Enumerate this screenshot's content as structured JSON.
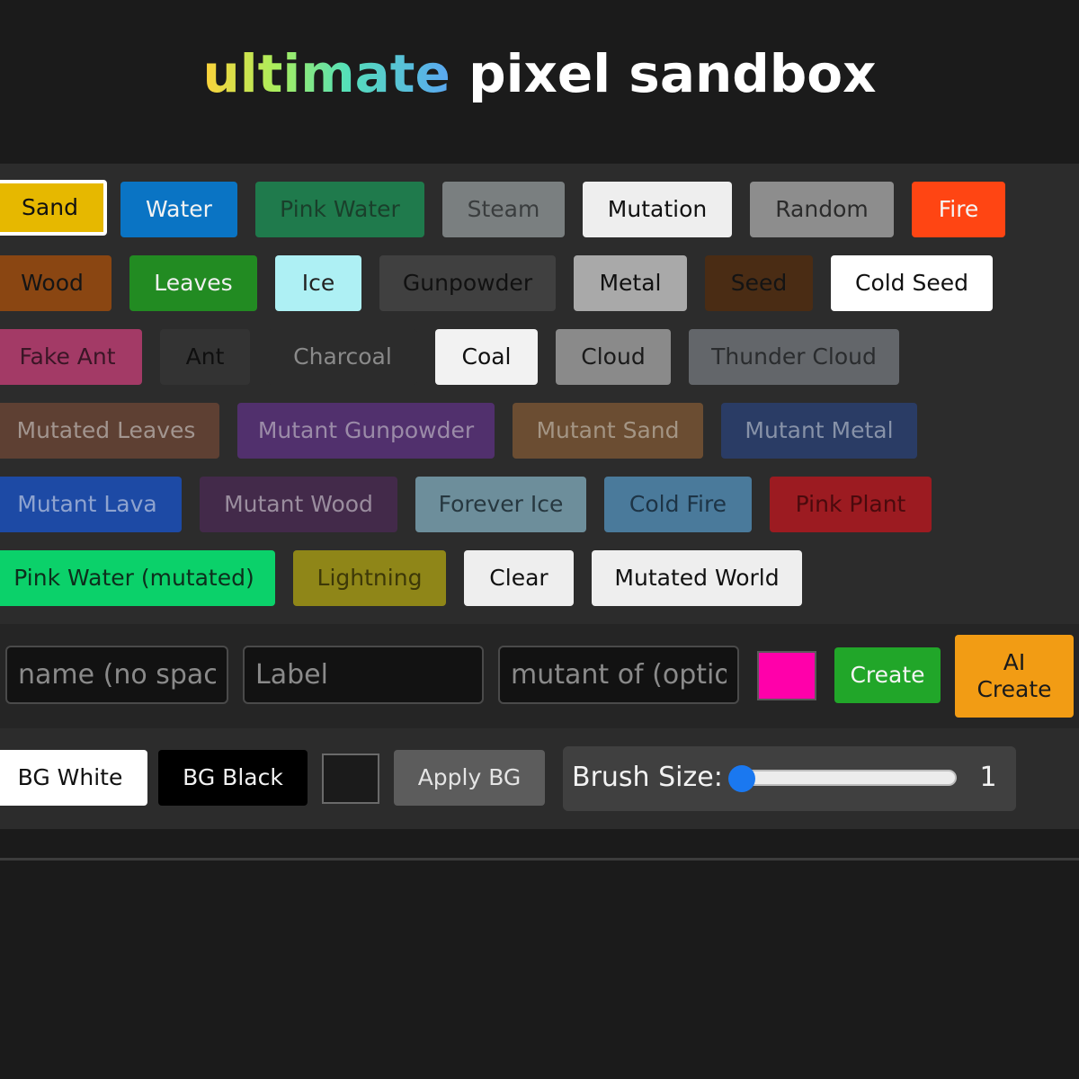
{
  "header": {
    "title_part1": "ultimate",
    "title_part2": "pixel sandbox"
  },
  "elements": [
    {
      "label": "Sand",
      "bg": "#e6b800",
      "fg": "#111111",
      "selected": true
    },
    {
      "label": "Water",
      "bg": "#0a74c4",
      "fg": "#f2f2f2"
    },
    {
      "label": "Pink Water",
      "bg": "#1f7a4c",
      "fg": "#1a3f2b"
    },
    {
      "label": "Steam",
      "bg": "#7a7f80",
      "fg": "#3a3d3e"
    },
    {
      "label": "Mutation",
      "bg": "#eeeeee",
      "fg": "#111111"
    },
    {
      "label": "Random",
      "bg": "#8d8d8d",
      "fg": "#2b2b2b"
    },
    {
      "label": "Fire",
      "bg": "#ff4513",
      "fg": "#f5f5f5"
    },
    {
      "label": "Wood",
      "bg": "#8a4612",
      "fg": "#151515"
    },
    {
      "label": "Leaves",
      "bg": "#228b22",
      "fg": "#f0f0f0"
    },
    {
      "label": "Ice",
      "bg": "#aef0f4",
      "fg": "#222222"
    },
    {
      "label": "Gunpowder",
      "bg": "#404040",
      "fg": "#111111"
    },
    {
      "label": "Metal",
      "bg": "#a9a9a9",
      "fg": "#111111"
    },
    {
      "label": "Seed",
      "bg": "#4a2c14",
      "fg": "#141414"
    },
    {
      "label": "Cold Seed",
      "bg": "#ffffff",
      "fg": "#111111"
    },
    {
      "label": "Fake Ant",
      "bg": "#a33a66",
      "fg": "#3a1626"
    },
    {
      "label": "Ant",
      "bg": "#333333",
      "fg": "#0f0f0f"
    },
    {
      "label": "Charcoal",
      "bg": "#2c2c2c",
      "fg": "#8a8a8a"
    },
    {
      "label": "Coal",
      "bg": "#f2f2f2",
      "fg": "#111111"
    },
    {
      "label": "Cloud",
      "bg": "#8a8a8a",
      "fg": "#1a1a1a"
    },
    {
      "label": "Thunder Cloud",
      "bg": "#63666a",
      "fg": "#2a2c2e"
    },
    {
      "label": "Mutated Leaves",
      "bg": "#5e4033",
      "fg": "#a2958f"
    },
    {
      "label": "Mutant Gunpowder",
      "bg": "#51306d",
      "fg": "#9b8ba8"
    },
    {
      "label": "Mutant Sand",
      "bg": "#6b4d32",
      "fg": "#a49584"
    },
    {
      "label": "Mutant Metal",
      "bg": "#2a3c65",
      "fg": "#8792a8"
    },
    {
      "label": "Mutant Lava",
      "bg": "#1d4aa5",
      "fg": "#8ea3cf"
    },
    {
      "label": "Mutant Wood",
      "bg": "#432a4a",
      "fg": "#9a8d9e"
    },
    {
      "label": "Forever Ice",
      "bg": "#6d8e9b",
      "fg": "#273840"
    },
    {
      "label": "Cold Fire",
      "bg": "#4a7a9b",
      "fg": "#1d3446"
    },
    {
      "label": "Pink Plant",
      "bg": "#9c1b21",
      "fg": "#4a0a0d"
    },
    {
      "label": "Pink Water (mutated)",
      "bg": "#0bd16a",
      "fg": "#0d2e1c"
    },
    {
      "label": "Lightning",
      "bg": "#8f8618",
      "fg": "#3d3808"
    },
    {
      "label": "Clear",
      "bg": "#eeeeee",
      "fg": "#111111"
    },
    {
      "label": "Mutated World",
      "bg": "#eeeeee",
      "fg": "#111111"
    }
  ],
  "create": {
    "name_placeholder": "name (no spaces)",
    "label_placeholder": "Label",
    "mutant_placeholder": "mutant of (optional)",
    "color_value": "#ff00aa",
    "create_label": "Create",
    "ai_label_line1": "AI",
    "ai_label_line2": "Create"
  },
  "background": {
    "white_label": "BG White",
    "black_label": "BG Black",
    "apply_label": "Apply BG",
    "custom_color": "#1b1b1b"
  },
  "brush": {
    "label": "Brush Size:",
    "value": "1",
    "min": 1,
    "max": 50
  }
}
